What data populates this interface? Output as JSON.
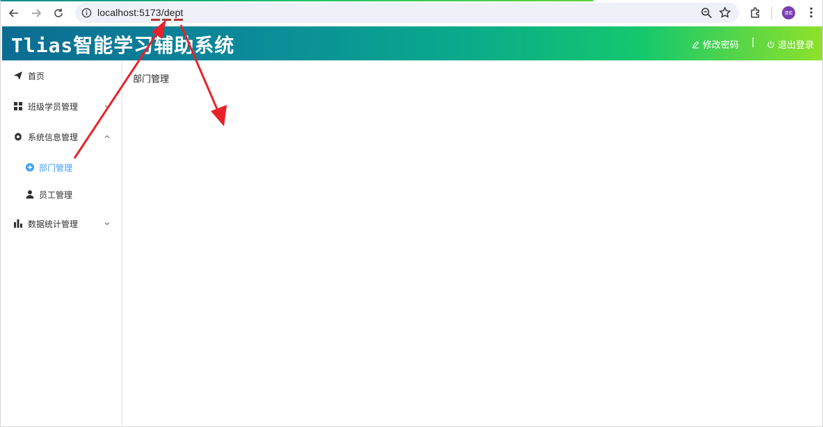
{
  "browser": {
    "url_host": "localhost:5173",
    "url_path": "/dept",
    "profile_initials": "清若"
  },
  "header": {
    "title": "Tlias智能学习辅助系统",
    "change_password": "修改密码",
    "separator": "|",
    "logout": "退出登录"
  },
  "sidebar": {
    "items": [
      {
        "label": "首页",
        "icon": "paper-plane-icon"
      },
      {
        "label": "班级学员管理",
        "icon": "grid-icon",
        "arrow": "chevron-down-icon"
      },
      {
        "label": "系统信息管理",
        "icon": "gear-icon",
        "arrow": "chevron-up-icon"
      },
      {
        "label": "部门管理",
        "icon": "plus-circle-icon",
        "active": true
      },
      {
        "label": "员工管理",
        "icon": "user-icon"
      },
      {
        "label": "数据统计管理",
        "icon": "bar-chart-icon",
        "arrow": "chevron-down-icon"
      }
    ]
  },
  "main": {
    "title": "部门管理"
  },
  "colors": {
    "active": "#409eff",
    "annotation": "#e8222a"
  }
}
